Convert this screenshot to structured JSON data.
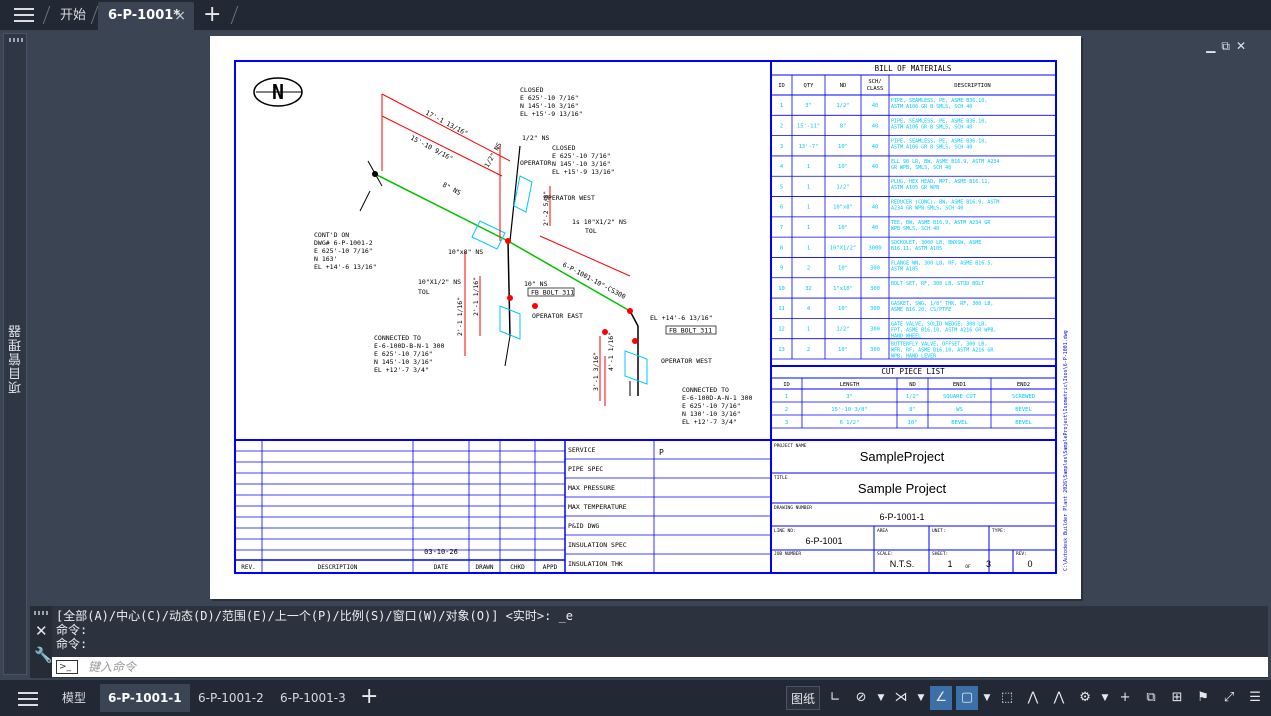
{
  "top_tabs": {
    "start": "开始",
    "drawing": "6-P-1001*",
    "close_glyph": "×",
    "add_glyph": "+"
  },
  "left_palette": {
    "label": "项目管理器"
  },
  "viewport_controls": {
    "minimize": "▁",
    "restore": "⧉",
    "close": "✕"
  },
  "drawing": {
    "north": "N",
    "bom": {
      "title": "BILL OF MATERIALS",
      "headers": [
        "ID",
        "QTY",
        "ND",
        "SCH/ CLASS",
        "DESCRIPTION"
      ],
      "rows": [
        [
          "1",
          "3\"",
          "1/2\"",
          "40",
          "PIPE, SEAMLESS, PE, ASME B36.10, ASTM A106 GR B SMLS, SCH 40"
        ],
        [
          "2",
          "15'-11\"",
          "8\"",
          "40",
          "PIPE, SEAMLESS, PE, ASME B36.10, ASTM A106 GR B SMLS, SCH 40"
        ],
        [
          "3",
          "13'-7\"",
          "10\"",
          "40",
          "PIPE, SEAMLESS, PE, ASME B36.10, ASTM A106 GR B SMLS, SCH 40"
        ],
        [
          "4",
          "1",
          "10\"",
          "40",
          "ELL 90 LR, BW, ASME B16.9, ASTM A234 GR WPB, SMLS, SCH 40"
        ],
        [
          "5",
          "1",
          "1/2\"",
          "",
          "PLUG, HEX HEAD, MPT, ASME B16.11, ASTM A105 GR WPB"
        ],
        [
          "6",
          "1",
          "10\"x8\"",
          "40",
          "REDUCER (CONC), BW, ASME B16.9, ASTM A234 GR WPB SMLS, SCH 40"
        ],
        [
          "7",
          "1",
          "10\"",
          "40",
          "TEE, BW, ASME B16.9, ASTM A234 GR WPB SMLS, SCH 40"
        ],
        [
          "8",
          "1",
          "10\"X1/2\"",
          "3000",
          "SOCKOLET, 3000 LB, BWXSW, ASME B16.11, ASTM A105"
        ],
        [
          "9",
          "2",
          "10\"",
          "300",
          "FLANGE WN, 300 LB, RF, ASME B16.5, ASTM A105"
        ],
        [
          "10",
          "32",
          "1\"x10\"",
          "300",
          "BOLT SET, RF, 300 LB, STUD BOLT"
        ],
        [
          "11",
          "4",
          "10\"",
          "300",
          "GASKET, SWG, 1/8\" THK, RF, 300 LB, ASME B16.20, CS/PTFE"
        ],
        [
          "12",
          "1",
          "1/2\"",
          "300",
          "GATE VALVE, SOLID WEDGE, 300 LB, FPT, ASME B16.10, ASTM A216 GR WPB, HAND WHEEL"
        ],
        [
          "13",
          "2",
          "10\"",
          "300",
          "BUTTERFLY VALVE, OFFSET, 300 LB, WFR, RF, ASME B16.10, ASTM A216 GR WPB, HAND LEVER"
        ]
      ]
    },
    "cut": {
      "title": "CUT PIECE LIST",
      "headers": [
        "ID",
        "LENGTH",
        "ND",
        "END1",
        "END2"
      ],
      "rows": [
        [
          "1",
          "3\"",
          "1/2\"",
          "SQUARE CUT",
          "SCREWED"
        ],
        [
          "2",
          "15'-10 3/8\"",
          "8\"",
          "WS",
          "BEVEL"
        ],
        [
          "3",
          "6 1/2\"",
          "10\"",
          "BEVEL",
          "BEVEL"
        ]
      ]
    },
    "revision": {
      "date_value": "03-10-26",
      "headers": [
        "REV.",
        "DESCRIPTION",
        "DATE",
        "DRAWN",
        "CHKD",
        "APPD"
      ]
    },
    "specs": {
      "labels": [
        "SERVICE",
        "PIPE SPEC",
        "MAX PRESSURE",
        "MAX TEMPERATURE",
        "P&ID DWG",
        "INSULATION SPEC",
        "INSULATION THK"
      ],
      "service_value": "P"
    },
    "title_block": {
      "project_name_label": "PROJECT NAME",
      "project_name": "SampleProject",
      "title_label": "TITLE",
      "title": "Sample Project",
      "drawing_number_label": "DRAWING NUMBER",
      "drawing_number": "6-P-1001-1",
      "line_no_label": "LINE NO:",
      "line_no": "6-P-1001",
      "area_label": "AREA",
      "unit_label": "UNIT:",
      "type_label": "TYPE:",
      "job_number_label": "JOB NUMBER",
      "scale_label": "SCALE:",
      "scale": "N.T.S.",
      "sheet_label": "SHEET:",
      "sheet": "1",
      "of_label": "OF",
      "sheet_total": "3",
      "rev_label": "REV:",
      "rev": "0"
    },
    "side_path": "C:\\Autodesk Builder Plant 2026\\Samples\\SampleProject\\Isometric\\Isos\\6-P-1001.dwg",
    "annotations": {
      "closed_1": [
        "CLOSED",
        "E 625'-10 7/16\"",
        "N 145'-10 3/16\"",
        "EL +15'-9 13/16\""
      ],
      "closed_2": [
        "CLOSED",
        "E 625'-10 7/16\"",
        "N 145'-10 3/16\"",
        "EL +15'-9 13/16\""
      ],
      "contd": [
        "CONT'D ON",
        "DWG# 6-P-1001-2",
        "E 625'-10 7/16\"",
        "N 163'",
        "EL +14'-6 13/16\""
      ],
      "conn_1": [
        "CONNECTED TO",
        "E-6-100D-B-N-1 300",
        "E 625'-10 7/16\"",
        "N 145'-10 3/16\"",
        "EL +12'-7 3/4\""
      ],
      "conn_2": [
        "CONNECTED TO",
        "E-6-100D-A-N-1 300",
        "E 625'-10 7/16\"",
        "N 130'-10 3/16\"",
        "EL +12'-7 3/4\""
      ],
      "dim_1": "17'-1 13/16\"",
      "dim_2": "15'-10 9/16\"",
      "dim_3": "8\" NS",
      "dim_4": "10\"x8\" NS",
      "dim_5": "10\"X1/2\" NS",
      "dim_5b": "TOL",
      "dim_6": "1/2\" NS",
      "dim_7": "10\" NS",
      "dim_8": "1/2\" NS",
      "dim_9": "1s 10\"X1/2\" NS",
      "dim_9b": "TOL",
      "dim_10": "6-P-1001-10\"-CS300",
      "dim_11": "EL +14'-6 13/16\"",
      "op_east": "OPERATOR EAST",
      "op_west_1": "OPERATOR WEST",
      "op_west_2": "OPERATOR WEST",
      "operator": "OPERATOR",
      "fb_1": "FB BOLT 311",
      "fb_2": "FB BOLT 311",
      "vdim_1": "2'-1 1/16\"",
      "vdim_2": "2'-1 1/16\"",
      "vdim_3": "2'-2 5/8\"",
      "vdim_4": "3'-1 3/16\"",
      "vdim_5": "4'-1 1/16\""
    }
  },
  "command_line": {
    "history": [
      "[全部(A)/中心(C)/动态(D)/范围(E)/上一个(P)/比例(S)/窗口(W)/对象(O)] <实时>: _e",
      "命令:",
      "命令:"
    ],
    "placeholder": "键入命令"
  },
  "layout_tabs": [
    "模型",
    "6-P-1001-1",
    "6-P-1001-2",
    "6-P-1001-3"
  ],
  "status_bar": {
    "paper": "图纸"
  },
  "colors": {
    "frame": "#0000ff",
    "text_cyan": "#00c8ff",
    "pipe_green": "#00c000",
    "dimension_red": "#ff0000"
  }
}
